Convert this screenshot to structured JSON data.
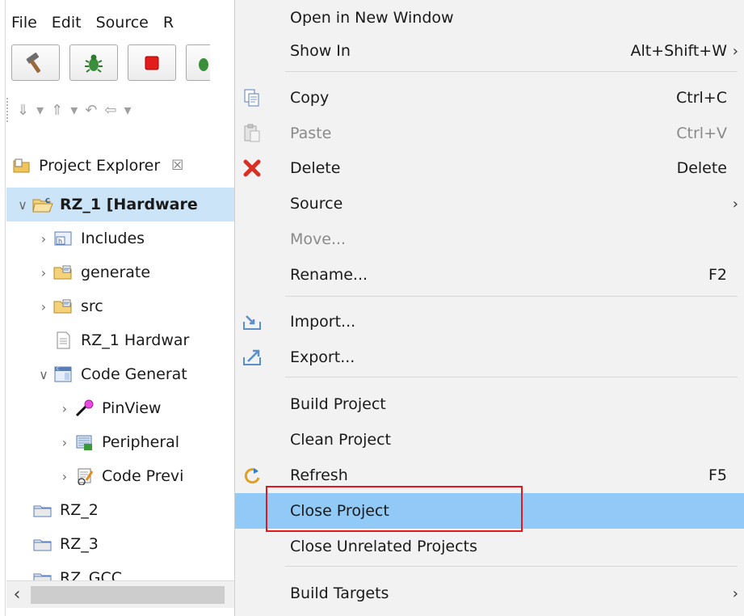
{
  "menubar": [
    "File",
    "Edit",
    "Source",
    "R"
  ],
  "explorer": {
    "title": "Project Explorer",
    "close_glyph": "☒",
    "tree": [
      {
        "indent": 0,
        "chev": "∨",
        "icon": "c-project-open-icon",
        "label": "RZ_1 [Hardware",
        "bold": true,
        "selected": true
      },
      {
        "indent": 1,
        "chev": "›",
        "icon": "includes-icon",
        "label": "Includes"
      },
      {
        "indent": 1,
        "chev": "›",
        "icon": "source-folder-icon",
        "label": "generate"
      },
      {
        "indent": 1,
        "chev": "›",
        "icon": "source-folder-icon",
        "label": "src"
      },
      {
        "indent": 1,
        "chev": "",
        "icon": "file-icon",
        "label": "RZ_1 Hardwar"
      },
      {
        "indent": 1,
        "chev": "∨",
        "icon": "code-generator-icon",
        "label": "Code Generat"
      },
      {
        "indent": 2,
        "chev": "›",
        "icon": "pin-icon",
        "label": "PinView"
      },
      {
        "indent": 2,
        "chev": "›",
        "icon": "peripheral-icon",
        "label": "Peripheral"
      },
      {
        "indent": 2,
        "chev": "›",
        "icon": "code-preview-icon",
        "label": "Code Previ"
      },
      {
        "indent": 0,
        "chev": "",
        "icon": "closed-project-icon",
        "label": "RZ_2"
      },
      {
        "indent": 0,
        "chev": "",
        "icon": "closed-project-icon",
        "label": "RZ_3"
      },
      {
        "indent": 0,
        "chev": "",
        "icon": "closed-project-icon",
        "label": "RZ_GCC"
      }
    ]
  },
  "menu": {
    "items": [
      {
        "label": "Open in New Window",
        "shortcut": "",
        "submenu": false,
        "icon": ""
      },
      {
        "label": "Show In",
        "shortcut": "Alt+Shift+W",
        "submenu": true,
        "icon": ""
      },
      {
        "label": "Copy",
        "shortcut": "Ctrl+C",
        "submenu": false,
        "icon": "copy-icon"
      },
      {
        "label": "Paste",
        "shortcut": "Ctrl+V",
        "submenu": false,
        "icon": "paste-icon",
        "disabled": true
      },
      {
        "label": "Delete",
        "shortcut": "Delete",
        "submenu": false,
        "icon": "delete-icon"
      },
      {
        "label": "Source",
        "shortcut": "",
        "submenu": true,
        "icon": ""
      },
      {
        "label": "Move...",
        "shortcut": "",
        "submenu": false,
        "icon": "",
        "disabled": true
      },
      {
        "label": "Rename...",
        "shortcut": "F2",
        "submenu": false,
        "icon": ""
      },
      {
        "label": "Import...",
        "shortcut": "",
        "submenu": false,
        "icon": "import-icon"
      },
      {
        "label": "Export...",
        "shortcut": "",
        "submenu": false,
        "icon": "export-icon"
      },
      {
        "label": "Build Project",
        "shortcut": "",
        "submenu": false,
        "icon": ""
      },
      {
        "label": "Clean Project",
        "shortcut": "",
        "submenu": false,
        "icon": ""
      },
      {
        "label": "Refresh",
        "shortcut": "F5",
        "submenu": false,
        "icon": "refresh-icon"
      },
      {
        "label": "Close Project",
        "shortcut": "",
        "submenu": false,
        "icon": "",
        "highlighted": true
      },
      {
        "label": "Close Unrelated Projects",
        "shortcut": "",
        "submenu": false,
        "icon": ""
      },
      {
        "label": "Build Targets",
        "shortcut": "",
        "submenu": true,
        "icon": ""
      }
    ],
    "submenu_arrow": "›"
  }
}
